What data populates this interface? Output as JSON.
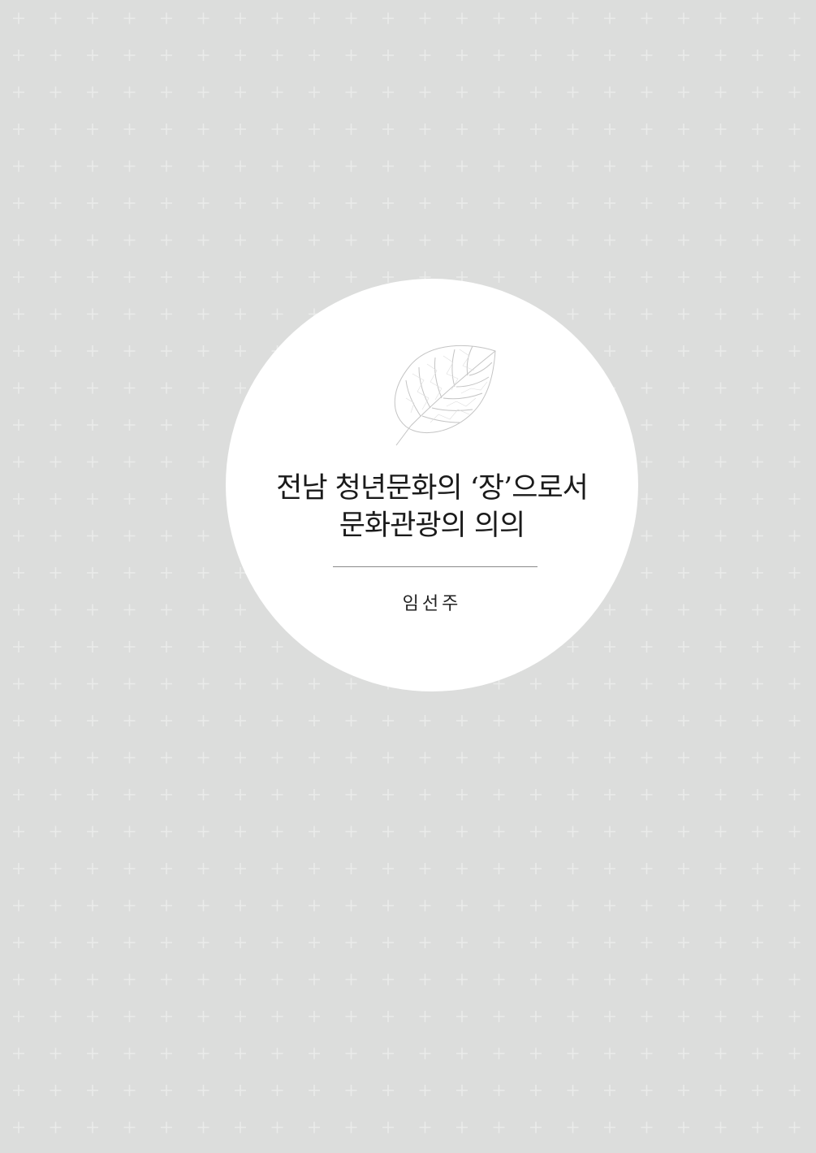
{
  "title": {
    "line1": "전남 청년문화의 ‘장’으로서",
    "line2": "문화관광의 의의"
  },
  "author": "임선주",
  "colors": {
    "background": "#dcdddc",
    "pattern_cross": "#e9eae9",
    "circle": "#ffffff",
    "leaf_line": "#c4c4c4",
    "text": "#1a1a1a"
  }
}
